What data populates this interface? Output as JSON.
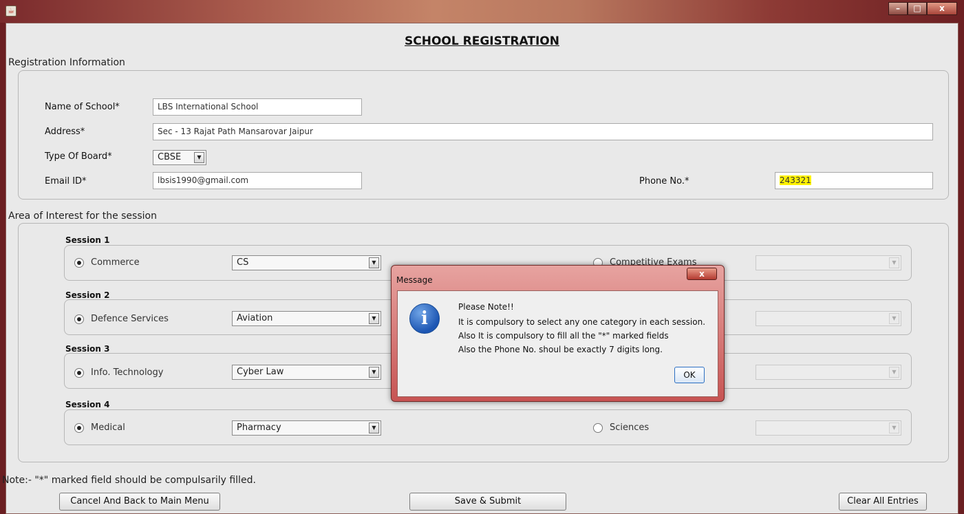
{
  "window": {
    "app_icon": "java-icon",
    "minimize": "–",
    "maximize": "□",
    "close": "x"
  },
  "form": {
    "title": "SCHOOL REGISTRATION",
    "registration_section_label": "Registration Information",
    "fields": {
      "name_label": "Name of School*",
      "name_value": "LBS International School",
      "address_label": "Address*",
      "address_value": "Sec - 13 Rajat Path Mansarovar Jaipur",
      "board_label": "Type Of Board*",
      "board_value": "CBSE",
      "email_label": "Email ID*",
      "email_value": "lbsis1990@gmail.com",
      "phone_label": "Phone No.*",
      "phone_value": "243321"
    },
    "interest_section_label": "Area of Interest for the session",
    "sessions": [
      {
        "title": "Session 1",
        "option_a": "Commerce",
        "option_a_value": "CS",
        "option_b": "Competitive Exams"
      },
      {
        "title": "Session 2",
        "option_a": "Defence Services",
        "option_a_value": "Aviation",
        "option_b": ""
      },
      {
        "title": "Session 3",
        "option_a": "Info. Technology",
        "option_a_value": "Cyber Law",
        "option_b": ""
      },
      {
        "title": "Session 4",
        "option_a": "Medical",
        "option_a_value": "Pharmacy",
        "option_b": "Sciences"
      }
    ],
    "note": "Note:- \"*\" marked field should be compulsarily filled.",
    "buttons": {
      "cancel": "Cancel And Back to Main Menu",
      "submit": "Save & Submit",
      "clear": "Clear All Entries"
    }
  },
  "dialog": {
    "title": "Message",
    "close": "x",
    "icon": "info-icon",
    "lines": [
      "Please Note!!",
      "It is compulsory to select any one category in each session.",
      "Also It is compulsory to fill all the \"*\" marked fields",
      "Also the Phone No. shoul be exactly 7 digits long."
    ],
    "ok_label": "OK"
  },
  "colors": {
    "window_bg": "#e9e9e9",
    "highlight": "#fff200",
    "dialog_frame": "#c75453"
  }
}
